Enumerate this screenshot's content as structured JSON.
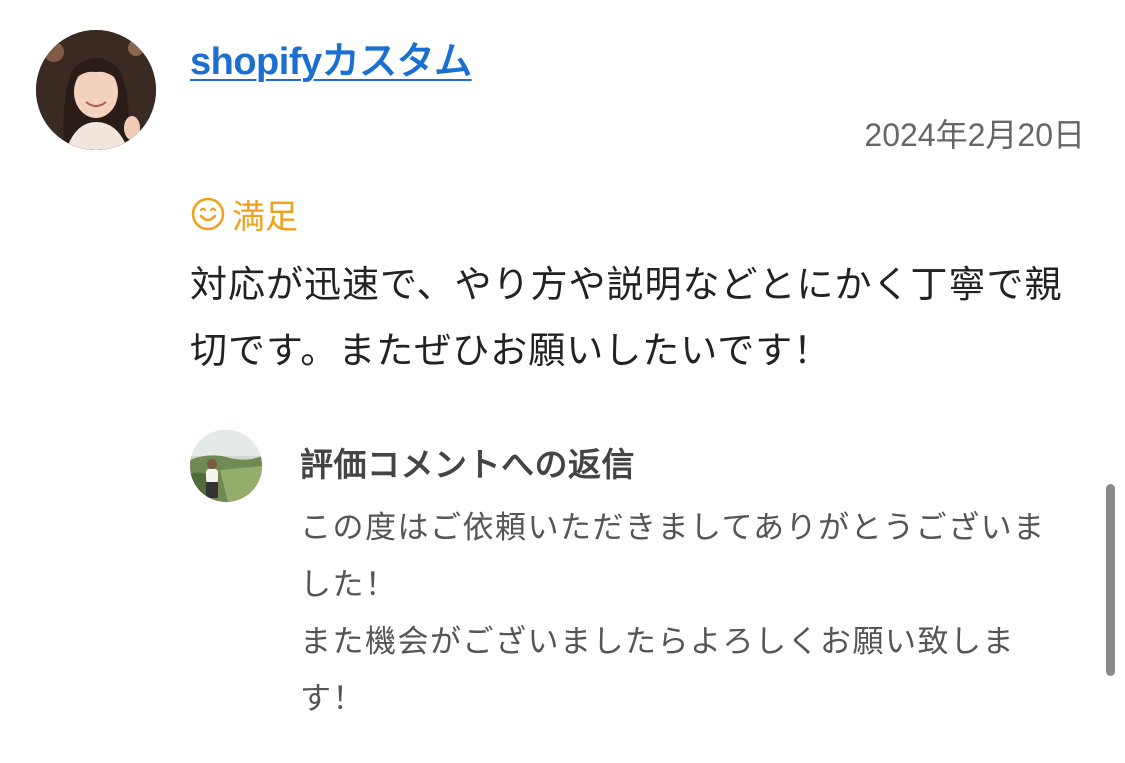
{
  "review": {
    "author": "shopifyカスタム",
    "date": "2024年2月20日",
    "rating_label": "満足",
    "rating_icon": "smile-icon",
    "comment": "対応が迅速で、やり方や説明などとにかく丁寧で親切です。またぜひお願いしたいです！"
  },
  "reply": {
    "title": "評価コメントへの返信",
    "lines": [
      "この度はご依頼いただきましてありがとうございました！",
      "また機会がございましたらよろしくお願い致します！"
    ]
  },
  "colors": {
    "link": "#1b6fd1",
    "rating": "#f0a01a",
    "date": "#666666"
  }
}
